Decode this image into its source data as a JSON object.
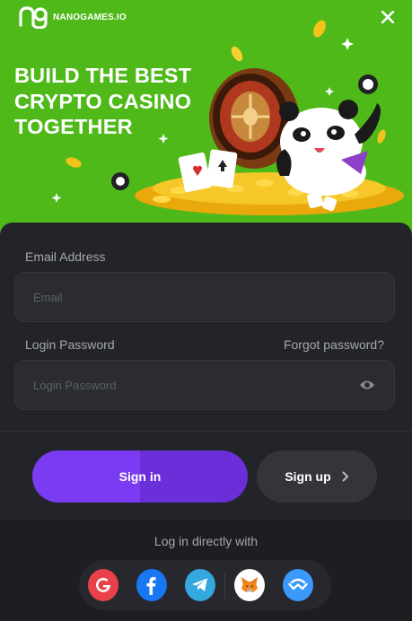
{
  "brand": {
    "name": "NANOGAMES.IO",
    "logo_text": "ng"
  },
  "banner": {
    "headline_line1": "BUILD THE BEST",
    "headline_line2": "CRYPTO CASINO",
    "headline_line3": "TOGETHER",
    "background_color": "#4fb91a"
  },
  "form": {
    "email_label": "Email Address",
    "email_placeholder": "Email",
    "email_value": "",
    "password_label": "Login Password",
    "password_placeholder": "Login Password",
    "password_value": "",
    "forgot_label": "Forgot password?"
  },
  "actions": {
    "signin_label": "Sign in",
    "signup_label": "Sign up",
    "accent_color": "#7a3bf2"
  },
  "social": {
    "title": "Log in directly with",
    "providers": [
      {
        "name": "google",
        "icon": "google-icon"
      },
      {
        "name": "facebook",
        "icon": "facebook-icon"
      },
      {
        "name": "telegram",
        "icon": "telegram-icon"
      },
      {
        "name": "metamask",
        "icon": "metamask-icon"
      },
      {
        "name": "walletconnect",
        "icon": "walletconnect-icon"
      }
    ]
  }
}
